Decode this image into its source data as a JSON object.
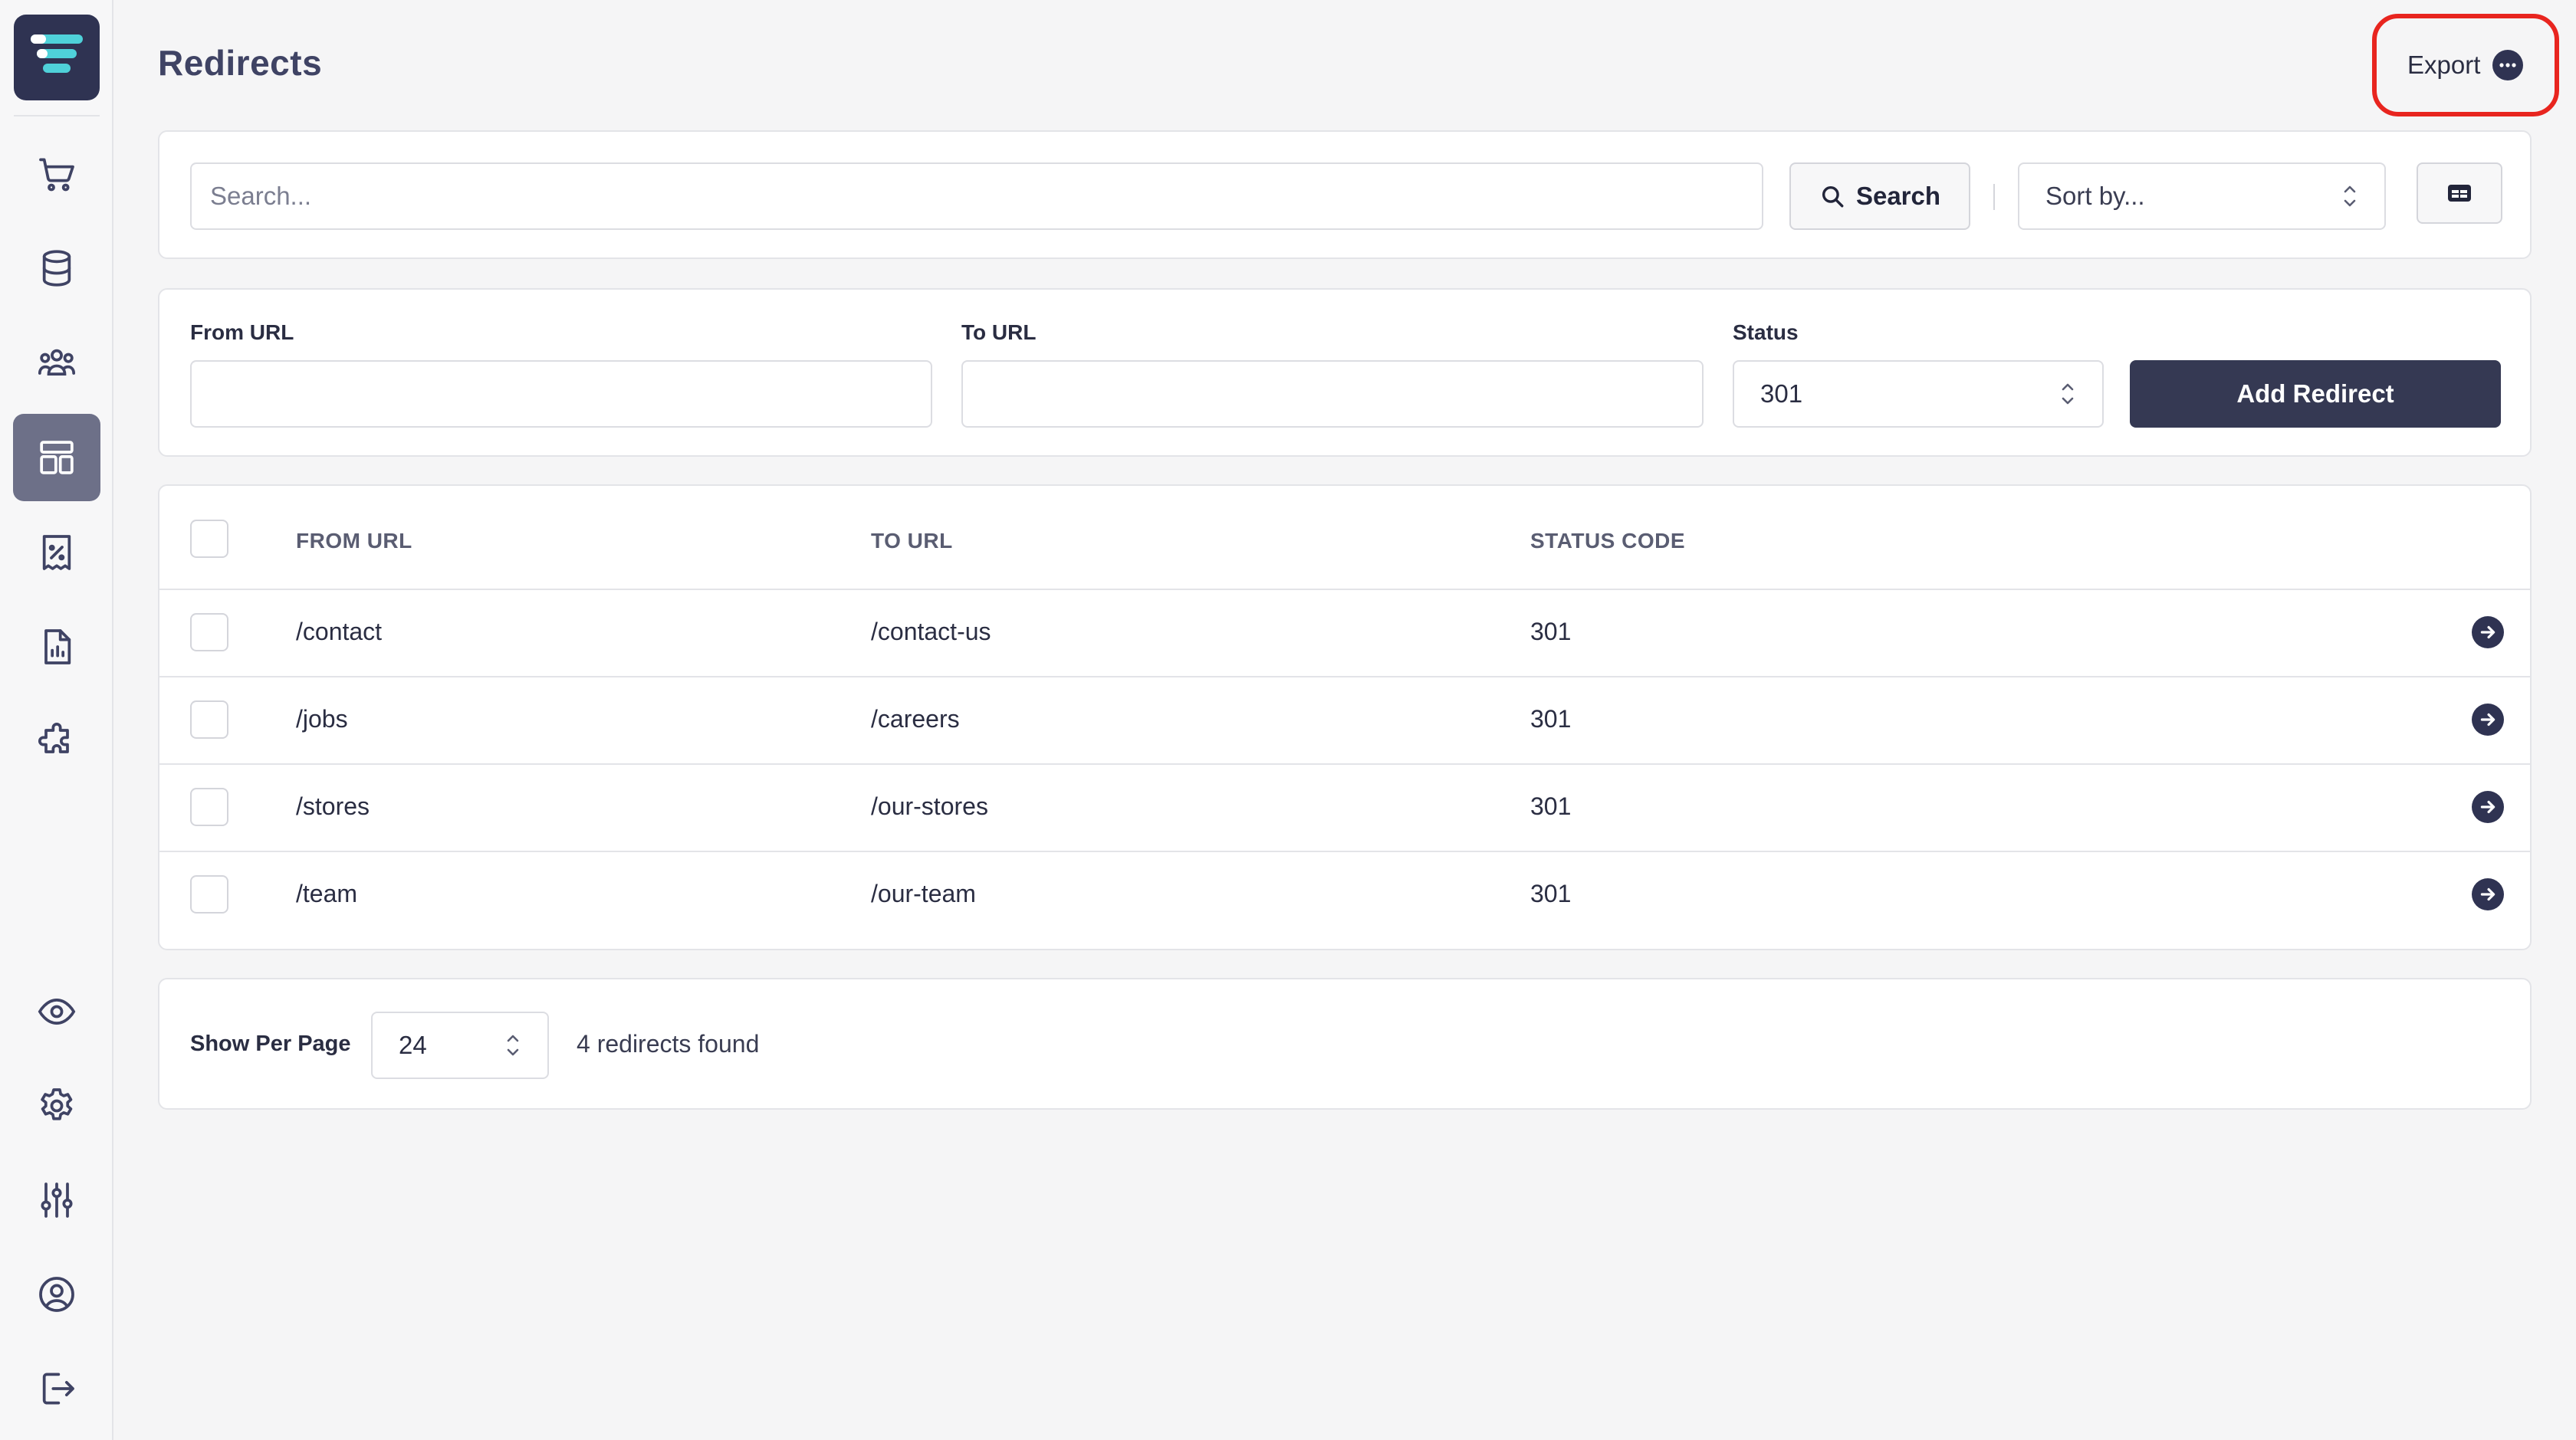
{
  "page": {
    "title": "Redirects"
  },
  "header": {
    "export_label": "Export"
  },
  "sidebar": {
    "items": [
      {
        "name": "cart",
        "icon": "cart-icon",
        "active": false
      },
      {
        "name": "database",
        "icon": "database-icon",
        "active": false
      },
      {
        "name": "users",
        "icon": "users-icon",
        "active": false
      },
      {
        "name": "layout",
        "icon": "layout-icon",
        "active": true
      },
      {
        "name": "discounts",
        "icon": "receipt-percent-icon",
        "active": false
      },
      {
        "name": "reports",
        "icon": "report-icon",
        "active": false
      },
      {
        "name": "plugins",
        "icon": "puzzle-icon",
        "active": false
      },
      {
        "name": "preview",
        "icon": "eye-icon",
        "active": false
      },
      {
        "name": "settings",
        "icon": "gear-icon",
        "active": false
      },
      {
        "name": "adjustments",
        "icon": "sliders-icon",
        "active": false
      },
      {
        "name": "account",
        "icon": "user-circle-icon",
        "active": false
      },
      {
        "name": "logout",
        "icon": "logout-icon",
        "active": false
      }
    ]
  },
  "search": {
    "placeholder": "Search...",
    "button_label": "Search",
    "sort_placeholder": "Sort by..."
  },
  "form": {
    "from_label": "From URL",
    "to_label": "To URL",
    "status_label": "Status",
    "status_value": "301",
    "add_label": "Add Redirect"
  },
  "table": {
    "columns": [
      "FROM URL",
      "TO URL",
      "STATUS CODE"
    ],
    "rows": [
      {
        "from": "/contact",
        "to": "/contact-us",
        "status": "301"
      },
      {
        "from": "/jobs",
        "to": "/careers",
        "status": "301"
      },
      {
        "from": "/stores",
        "to": "/our-stores",
        "status": "301"
      },
      {
        "from": "/team",
        "to": "/our-team",
        "status": "301"
      }
    ]
  },
  "pager": {
    "label": "Show Per Page",
    "per_page": "24",
    "found_text": "4 redirects found"
  },
  "colors": {
    "accent": "#2f3352",
    "logo_teal": "#4fd1d9",
    "highlight": "#e8251f",
    "active_nav": "#6d7088"
  }
}
